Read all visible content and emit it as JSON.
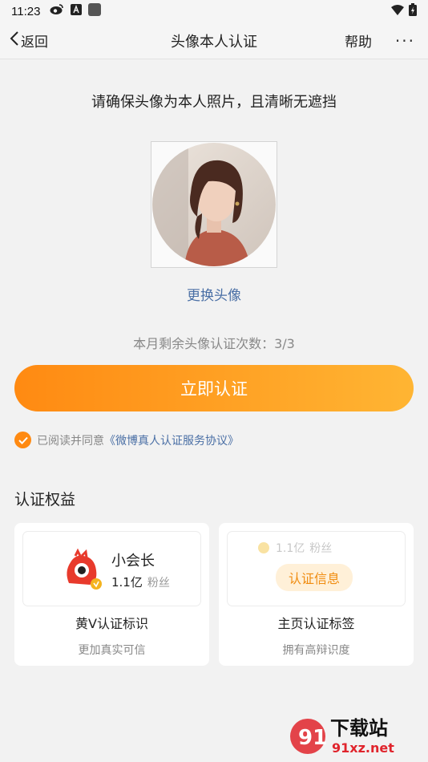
{
  "status_bar": {
    "time": "11:23"
  },
  "nav": {
    "back_label": "返回",
    "title": "头像本人认证",
    "help_label": "帮助",
    "more_label": "···"
  },
  "hint": "请确保头像为本人照片，且清晰无遮挡",
  "change_avatar_label": "更换头像",
  "remaining_text": "本月剩余头像认证次数：3/3",
  "cta_label": "立即认证",
  "agreement": {
    "prefix": "已阅读并同意",
    "link": "《微博真人认证服务协议》"
  },
  "benefits": {
    "title": "认证权益",
    "cards": [
      {
        "user_name": "小会长",
        "fans_count": "1.1亿",
        "fans_unit": "粉丝",
        "label": "黄V认证标识",
        "sub": "更加真实可信"
      },
      {
        "fans_count": "1.1亿",
        "fans_unit": "粉丝",
        "badge": "认证信息",
        "label": "主页认证标签",
        "sub": "拥有高辩识度"
      }
    ]
  },
  "watermark": {
    "text": "下载站",
    "site": "91xz.net"
  },
  "colors": {
    "accent": "#ff8a12",
    "link": "#4a6fa5",
    "badge_bg": "#fff0d8"
  }
}
